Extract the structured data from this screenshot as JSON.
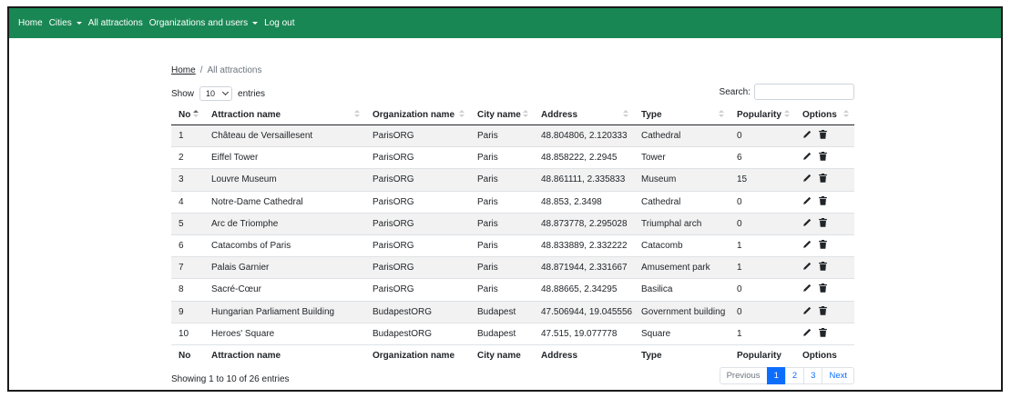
{
  "nav": {
    "home": "Home",
    "cities": "Cities",
    "attractions": "All attractions",
    "orgs": "Organizations and users",
    "logout": "Log out"
  },
  "breadcrumb": {
    "home": "Home",
    "separator": "/",
    "current": "All attractions"
  },
  "length": {
    "prefix": "Show",
    "value": "10",
    "suffix": "entries"
  },
  "search": {
    "label": "Search:"
  },
  "table": {
    "headers": [
      "No",
      "Attraction name",
      "Organization name",
      "City name",
      "Address",
      "Type",
      "Popularity",
      "Options"
    ],
    "rows": [
      [
        "1",
        "Château de Versaillesent",
        "ParisORG",
        "Paris",
        "48.804806, 2.120333",
        "Cathedral",
        "0"
      ],
      [
        "2",
        "Eiffel Tower",
        "ParisORG",
        "Paris",
        "48.858222, 2.2945",
        "Tower",
        "6"
      ],
      [
        "3",
        "Louvre Museum",
        "ParisORG",
        "Paris",
        "48.861111, 2.335833",
        "Museum",
        "15"
      ],
      [
        "4",
        "Notre-Dame Cathedral",
        "ParisORG",
        "Paris",
        "48.853, 2.3498",
        "Cathedral",
        "0"
      ],
      [
        "5",
        "Arc de Triomphe",
        "ParisORG",
        "Paris",
        "48.873778, 2.295028",
        "Triumphal arch",
        "0"
      ],
      [
        "6",
        "Catacombs of Paris",
        "ParisORG",
        "Paris",
        "48.833889, 2.332222",
        "Catacomb",
        "1"
      ],
      [
        "7",
        "Palais Garnier",
        "ParisORG",
        "Paris",
        "48.871944, 2.331667",
        "Amusement park",
        "1"
      ],
      [
        "8",
        "Sacré-Cœur",
        "ParisORG",
        "Paris",
        "48.88665, 2.34295",
        "Basilica",
        "0"
      ],
      [
        "9",
        "Hungarian Parliament Building",
        "BudapestORG",
        "Budapest",
        "47.506944, 19.045556",
        "Government building",
        "0"
      ],
      [
        "10",
        "Heroes' Square",
        "BudapestORG",
        "Budapest",
        "47.515, 19.077778",
        "Square",
        "1"
      ]
    ]
  },
  "info": "Showing 1 to 10 of 26 entries",
  "pagination": {
    "previous": "Previous",
    "pages": [
      "1",
      "2",
      "3"
    ],
    "next": "Next"
  },
  "colors": {
    "navbar": "#198754",
    "link": "#0d6efd"
  }
}
